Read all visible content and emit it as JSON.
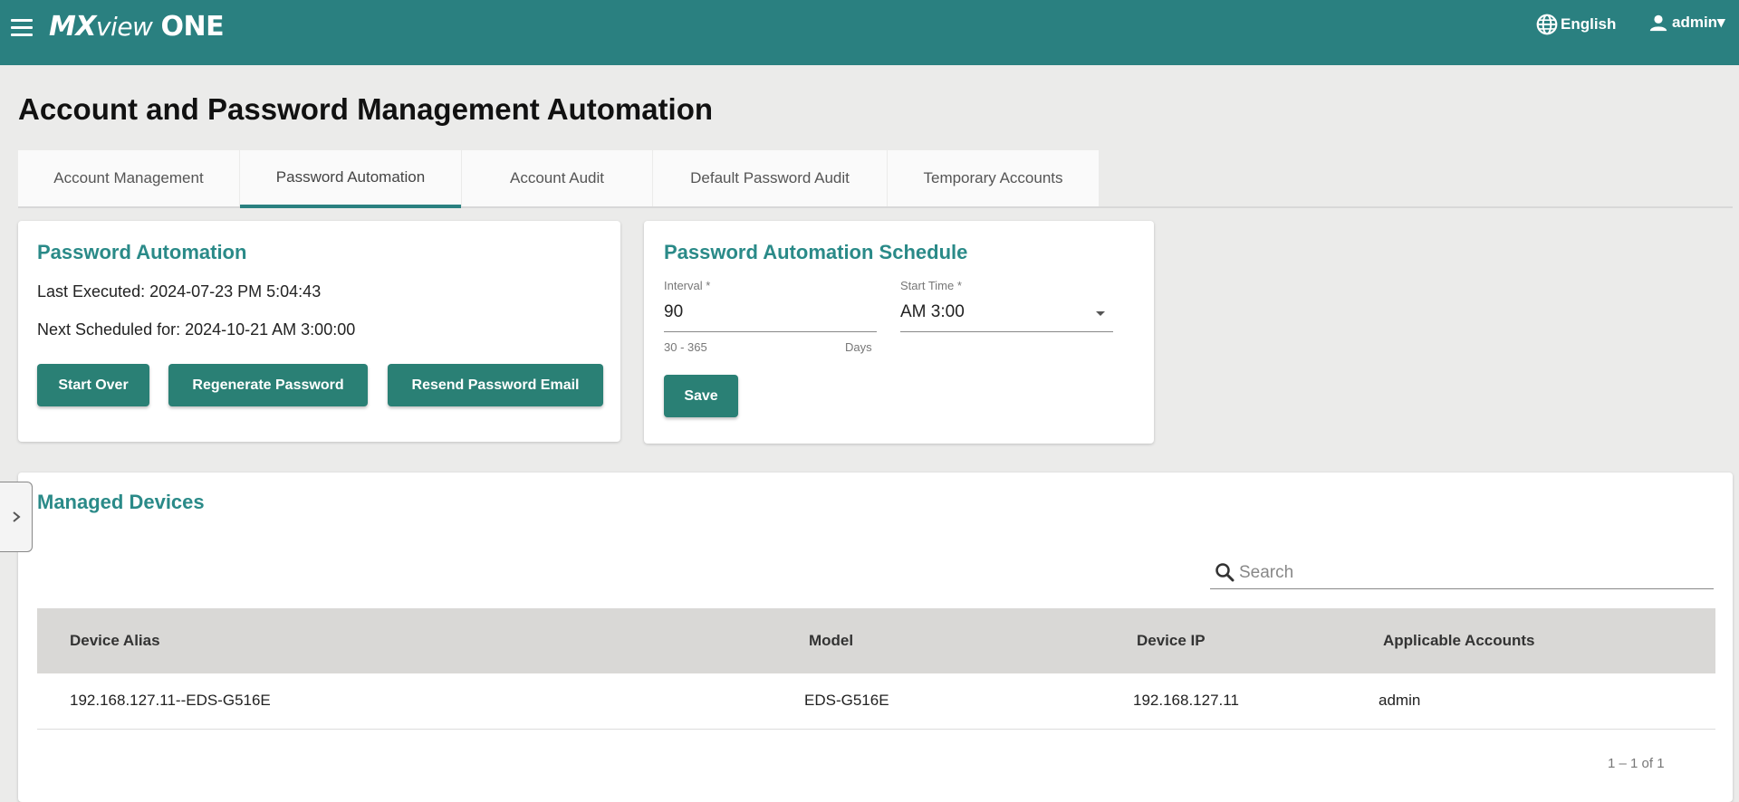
{
  "header": {
    "brand_mx": "MX",
    "brand_view": "view",
    "brand_one": "ONE",
    "language": "English",
    "user": "admin▾"
  },
  "page": {
    "title": "Account and Password Management Automation"
  },
  "tabs": [
    {
      "label": "Account Management"
    },
    {
      "label": "Password Automation",
      "active": true
    },
    {
      "label": "Account Audit"
    },
    {
      "label": "Default Password Audit"
    },
    {
      "label": "Temporary Accounts"
    }
  ],
  "password_automation": {
    "title": "Password Automation",
    "last_executed": "Last Executed: 2024-07-23 PM 5:04:43",
    "next_scheduled": "Next Scheduled for: 2024-10-21 AM 3:00:00",
    "start_over": "Start Over",
    "regenerate": "Regenerate Password",
    "resend": "Resend Password Email"
  },
  "schedule": {
    "title": "Password Automation Schedule",
    "interval_label": "Interval *",
    "interval_value": "90",
    "interval_range": "30 - 365",
    "interval_unit": "Days",
    "start_time_label": "Start Time *",
    "start_time_value": "AM 3:00",
    "save": "Save"
  },
  "devices": {
    "title": "Managed Devices",
    "search_placeholder": "Search",
    "columns": [
      "Device Alias",
      "Model",
      "Device IP",
      "Applicable Accounts"
    ],
    "rows": [
      [
        "192.168.127.11--EDS-G516E",
        "EDS-G516E",
        "192.168.127.11",
        "admin"
      ]
    ],
    "pagination": "1 – 1 of 1"
  },
  "colors": {
    "brand": "#2a8080",
    "accent_title": "#2a8a88",
    "button": "#2a8075"
  }
}
